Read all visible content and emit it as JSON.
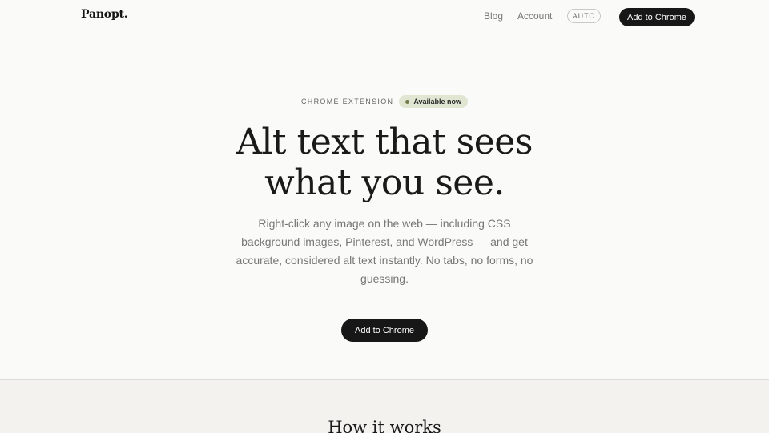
{
  "header": {
    "logo": "Panopt",
    "logo_dot": ".",
    "nav": {
      "blog": "Blog",
      "account": "Account"
    },
    "theme_toggle": "AUTO",
    "cta": "Add to Chrome"
  },
  "hero": {
    "eyebrow": "CHROME EXTENSION",
    "badge": "Available now",
    "headline_line1": "Alt text that sees",
    "headline_line2": "what you see.",
    "description": "Right-click any image on the web — including CSS background images, Pinterest, and WordPress — and get accurate, considered alt text instantly. No tabs, no forms, no guessing.",
    "cta": "Add to Chrome"
  },
  "how_it_works": {
    "title": "How it works"
  },
  "colors": {
    "background": "#fafaf8",
    "button": "#171717",
    "badge_bg": "#e1e6d3",
    "section_bg": "#f3f2ee"
  }
}
